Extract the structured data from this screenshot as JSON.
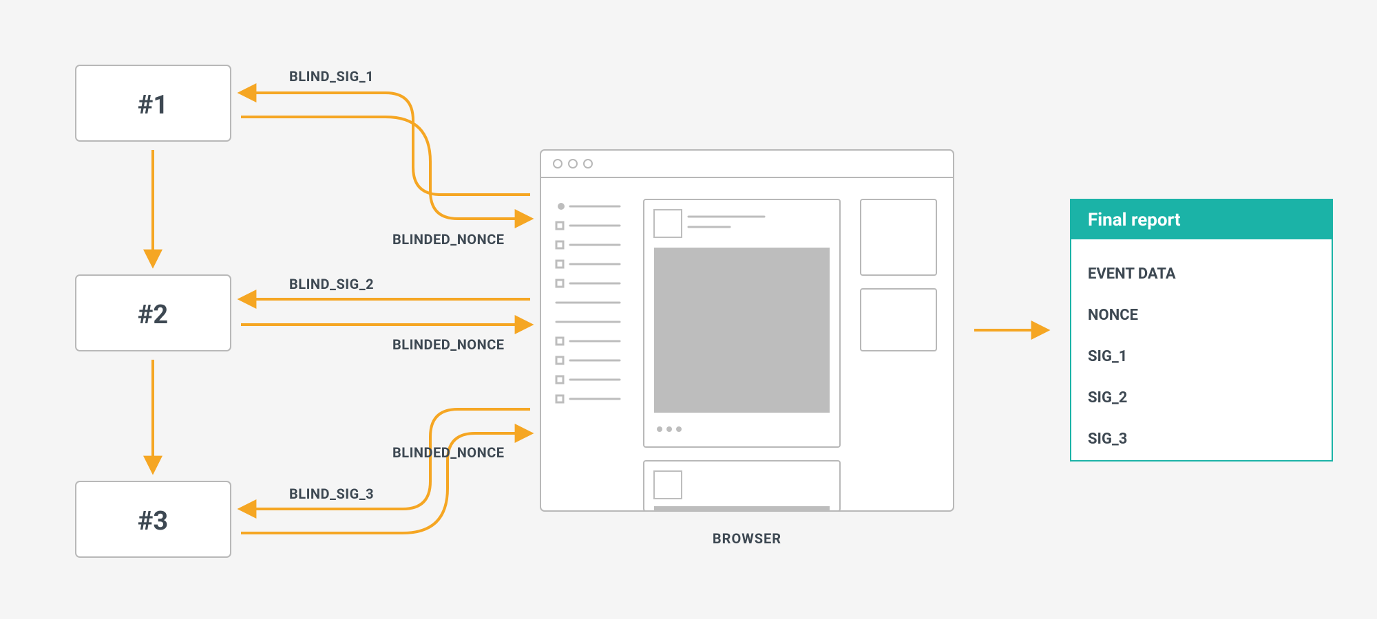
{
  "nodes": {
    "n1": "#1",
    "n2": "#2",
    "n3": "#3"
  },
  "flows": {
    "sig1": "BLIND_SIG_1",
    "sig2": "BLIND_SIG_2",
    "sig3": "BLIND_SIG_3",
    "nonce1": "BLINDED_NONCE",
    "nonce2": "BLINDED_NONCE",
    "nonce3": "BLINDED_NONCE"
  },
  "browser_caption": "BROWSER",
  "report": {
    "title": "Final report",
    "items": [
      "EVENT DATA",
      "NONCE",
      "SIG_1",
      "SIG_2",
      "SIG_3"
    ]
  },
  "colors": {
    "arrow": "#f5a623",
    "box_stroke": "#b8b8b8",
    "teal": "#1bb3a7",
    "grey_fill": "#bdbdbd",
    "grey_line": "#bdbdbd"
  }
}
